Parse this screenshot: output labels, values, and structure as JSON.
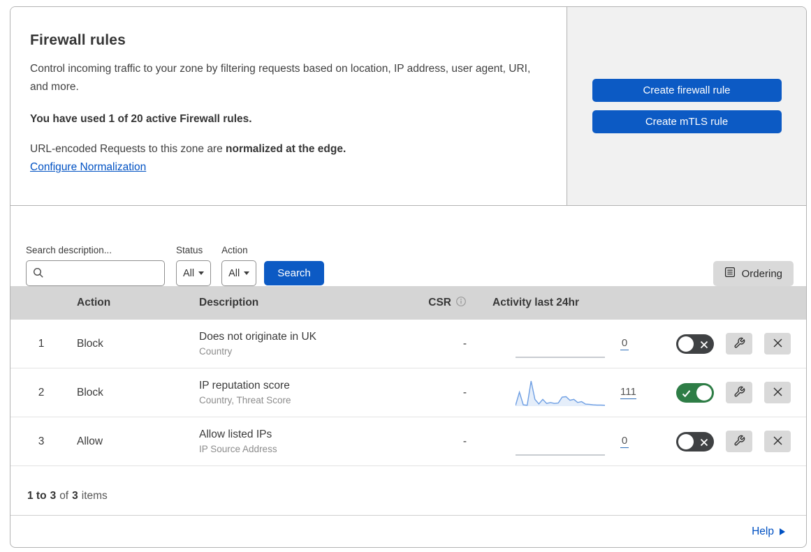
{
  "header": {
    "title": "Firewall rules",
    "description": "Control incoming traffic to your zone by filtering requests based on location, IP address, user agent, URI, and more.",
    "usage_notice": "You have used 1 of 20 active Firewall rules.",
    "normalization_prefix": "URL-encoded Requests to this zone are ",
    "normalization_bold": "normalized at the edge.",
    "normalization_link": "Configure Normalization",
    "create_firewall_button": "Create firewall rule",
    "create_mtls_button": "Create mTLS rule"
  },
  "filters": {
    "search_label": "Search description...",
    "status_label": "Status",
    "status_value": "All",
    "action_label": "Action",
    "action_value": "All",
    "search_button": "Search",
    "ordering_button": "Ordering"
  },
  "table": {
    "columns": {
      "action": "Action",
      "description": "Description",
      "csr": "CSR",
      "activity": "Activity last 24hr"
    },
    "rows": [
      {
        "number": "1",
        "action": "Block",
        "title": "Does not originate in UK",
        "subtitle": "Country",
        "csr": "-",
        "count": "0",
        "enabled": false,
        "activity": [
          0,
          0,
          0,
          0,
          0,
          0,
          0,
          0,
          0,
          0,
          0,
          0,
          0,
          0,
          0,
          0,
          0,
          0,
          0,
          0,
          0,
          0,
          0,
          0
        ]
      },
      {
        "number": "2",
        "action": "Block",
        "title": "IP reputation score",
        "subtitle": "Country, Threat Score",
        "csr": "-",
        "count": "111",
        "enabled": true,
        "activity": [
          3,
          62,
          6,
          4,
          111,
          30,
          10,
          30,
          12,
          16,
          12,
          14,
          40,
          42,
          26,
          30,
          16,
          20,
          9,
          8,
          6,
          5,
          5,
          4
        ]
      },
      {
        "number": "3",
        "action": "Allow",
        "title": "Allow listed IPs",
        "subtitle": "IP Source Address",
        "csr": "-",
        "count": "0",
        "enabled": false,
        "activity": [
          0,
          0,
          0,
          0,
          0,
          0,
          0,
          0,
          0,
          0,
          0,
          0,
          0,
          0,
          0,
          0,
          0,
          0,
          0,
          0,
          0,
          0,
          0,
          0
        ]
      }
    ]
  },
  "footer": {
    "range": "1 to",
    "range_end": "3",
    "of_label": "of",
    "total": "3",
    "items_label": "items",
    "help_label": "Help"
  },
  "colors": {
    "primary_blue": "#0c5ac4",
    "link_blue": "#0051c3",
    "toggle_on_green": "#2e7d46",
    "toggle_off_gray": "#3f4143",
    "panel_gray": "#f1f1f1",
    "table_header_gray": "#d5d5d5",
    "sparkline_blue": "#6d9ee3"
  }
}
